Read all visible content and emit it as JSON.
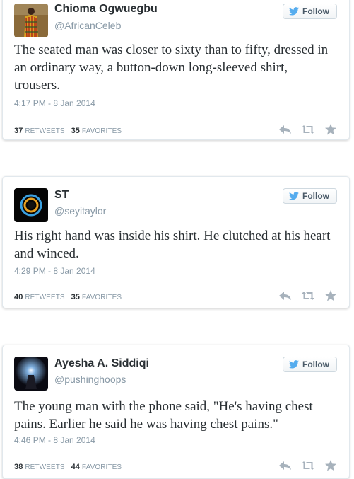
{
  "follow_label": "Follow",
  "stats_labels": {
    "retweets": "RETWEETS",
    "favorites": "FAVORITES"
  },
  "tweets": [
    {
      "name": "Chioma Ogwuegbu",
      "handle": "@AfricanCeleb",
      "text": "The seated man was closer to sixty than to fifty, dressed in an ordinary way, a button-down long-sleeved shirt, trousers.",
      "time": "4:17 PM - 8 Jan 2014",
      "retweets": "37",
      "favorites": "35"
    },
    {
      "name": "ST",
      "handle": "@seyitaylor",
      "text": "His right hand was inside his shirt. He clutched at his heart and winced.",
      "time": "4:29 PM - 8 Jan 2014",
      "retweets": "40",
      "favorites": "35"
    },
    {
      "name": "Ayesha A. Siddiqi",
      "handle": "@pushinghoops",
      "text": "The young man with the phone said, \"He's having chest pains. Earlier he said he was having chest pains.\"",
      "time": "4:46 PM - 8 Jan 2014",
      "retweets": "38",
      "favorites": "44"
    }
  ],
  "colors": {
    "text": "#292f33",
    "muted": "#8899a6",
    "icon": "#a7b2bc",
    "bird": "#55acee",
    "border": "#e1e8ed"
  },
  "icons": [
    "twitter-bird-icon",
    "reply-icon",
    "retweet-icon",
    "favorite-star-icon"
  ]
}
